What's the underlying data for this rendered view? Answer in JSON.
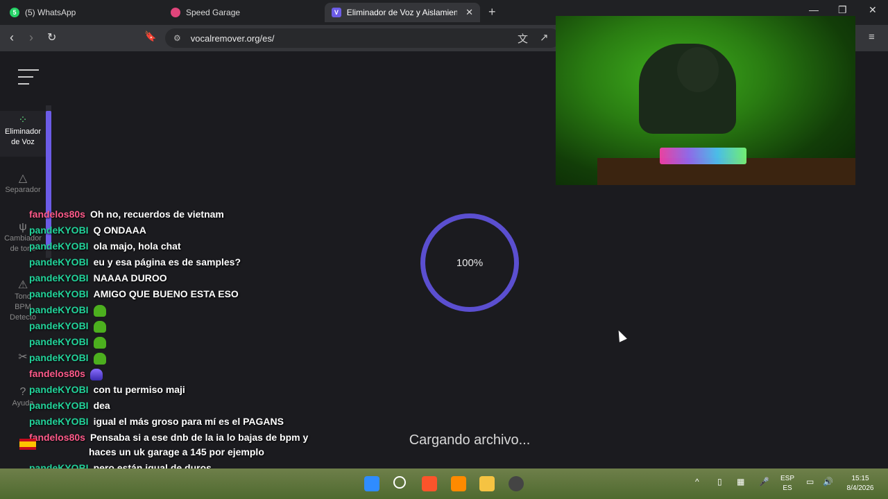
{
  "tabs": [
    {
      "label": "(5) WhatsApp",
      "favicon": "5",
      "color": "#25d366"
    },
    {
      "label": "Speed Garage",
      "favicon": "",
      "color": "#e0457b"
    },
    {
      "label": "Eliminador de Voz y Aislamiento",
      "favicon": "V",
      "color": "#6c5ce7"
    }
  ],
  "address": {
    "url": "vocalremover.org/es/"
  },
  "sidebar": {
    "items": [
      {
        "label1": "Eliminador",
        "label2": "de Voz"
      },
      {
        "label1": "Separador",
        "label2": ""
      },
      {
        "label1": "Cambiador",
        "label2": "de tono"
      },
      {
        "label1": "Tono",
        "label2": "BPM"
      },
      {
        "label1": "Detecto",
        "label2": ""
      },
      {
        "label1": "Ayuda",
        "label2": ""
      }
    ]
  },
  "progress": {
    "percent_label": "100%",
    "value": 100,
    "status": "Cargando archivo..."
  },
  "chat": [
    {
      "user": "fandelos80s",
      "color": "pink",
      "text": "Oh no, recuerdos de vietnam"
    },
    {
      "user": "pandeKYOBI",
      "color": "green",
      "text": "Q ONDAAA"
    },
    {
      "user": "pandeKYOBI",
      "color": "green",
      "text": "ola majo, hola chat"
    },
    {
      "user": "pandeKYOBI",
      "color": "green",
      "text": "eu y esa página es de samples?"
    },
    {
      "user": "pandeKYOBI",
      "color": "green",
      "text": "NAAAA DUROO"
    },
    {
      "user": "pandeKYOBI",
      "color": "green",
      "text": "AMIGO QUE BUENO ESTA ESO"
    },
    {
      "user": "pandeKYOBI",
      "color": "green",
      "text": ""
    },
    {
      "user": "pandeKYOBI",
      "color": "green",
      "text": ""
    },
    {
      "user": "pandeKYOBI",
      "color": "green",
      "text": ""
    },
    {
      "user": "pandeKYOBI",
      "color": "green",
      "text": ""
    },
    {
      "user": "fandelos80s",
      "color": "pink",
      "text": ""
    },
    {
      "user": "pandeKYOBI",
      "color": "green",
      "text": "con tu permiso maji"
    },
    {
      "user": "pandeKYOBI",
      "color": "green",
      "text": "dea"
    },
    {
      "user": "pandeKYOBI",
      "color": "green",
      "text": "igual el más groso para mí es el PAGANS"
    },
    {
      "user": "fandelos80s",
      "color": "pink",
      "text": "Pensaba si a ese dnb de la ia lo bajas de bpm y"
    },
    {
      "user": "",
      "color": "pink",
      "text": "haces un uk garage a 145 por ejemplo"
    },
    {
      "user": "pandeKYOBI",
      "color": "green",
      "text": "pero están igual de duros"
    }
  ],
  "taskbar": {
    "lang1": "ESP",
    "lang2": "ES",
    "time": "15:15",
    "date": "8/4/2026"
  }
}
